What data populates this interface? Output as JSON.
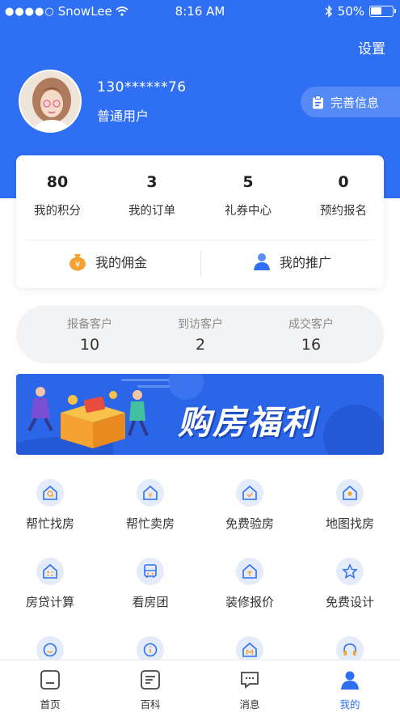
{
  "status_bar": {
    "carrier": "SnowLee",
    "time": "8:16 AM",
    "battery": "50%"
  },
  "header": {
    "settings_label": "设置",
    "phone": "130******76",
    "user_type": "普通用户",
    "complete_info_label": "完善信息"
  },
  "stats": [
    {
      "num": "80",
      "label": "我的积分"
    },
    {
      "num": "3",
      "label": "我的订单"
    },
    {
      "num": "5",
      "label": "礼券中心"
    },
    {
      "num": "0",
      "label": "预约报名"
    }
  ],
  "quick_links": {
    "commission": "我的佣金",
    "promotion": "我的推广"
  },
  "customers": [
    {
      "label": "报备客户",
      "num": "10"
    },
    {
      "label": "到访客户",
      "num": "2"
    },
    {
      "label": "成交客户",
      "num": "16"
    }
  ],
  "banner": {
    "title": "购房福利"
  },
  "services": [
    {
      "label": "帮忙找房",
      "icon": "house-search-icon"
    },
    {
      "label": "帮忙卖房",
      "icon": "house-yen-icon"
    },
    {
      "label": "免费验房",
      "icon": "house-check-icon"
    },
    {
      "label": "地图找房",
      "icon": "map-pin-icon"
    },
    {
      "label": "房贷计算",
      "icon": "calculator-icon"
    },
    {
      "label": "看房团",
      "icon": "bus-icon"
    },
    {
      "label": "装修报价",
      "icon": "house-price-icon"
    },
    {
      "label": "免费设计",
      "icon": "star-design-icon"
    },
    {
      "label": "",
      "icon": "smile-icon"
    },
    {
      "label": "",
      "icon": "info-icon"
    },
    {
      "label": "",
      "icon": "house-m-icon"
    },
    {
      "label": "",
      "icon": "headphones-icon"
    }
  ],
  "tabs": [
    {
      "label": "首页",
      "icon": "home-icon"
    },
    {
      "label": "百科",
      "icon": "encyclopedia-icon"
    },
    {
      "label": "消息",
      "icon": "message-icon"
    },
    {
      "label": "我的",
      "icon": "profile-icon",
      "active": true
    }
  ],
  "colors": {
    "primary": "#2f6ff4",
    "icon_bg": "#e4ecfb",
    "pill_bg": "#f2f3f5",
    "gold": "#f5a233"
  }
}
